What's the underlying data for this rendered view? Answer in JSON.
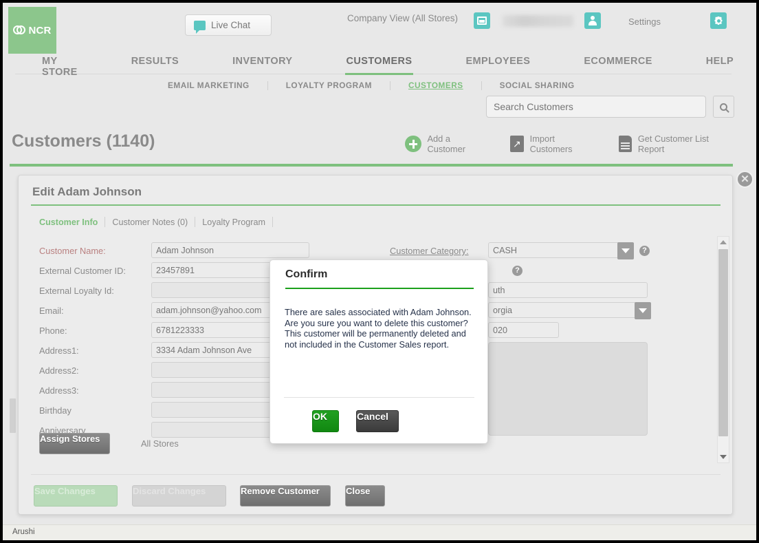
{
  "colors": {
    "brand_green": "#7ec07e",
    "teal": "#5bc6c1",
    "confirm_green": "#1ba01b",
    "page_bg": "#e8e8e8"
  },
  "header": {
    "logo_text": "NCR",
    "live_chat": "Live Chat",
    "company_view": "Company View (All Stores)",
    "settings": "Settings",
    "store_icon": "store-icon",
    "user_icon": "user-icon",
    "gear_icon": "gear-icon"
  },
  "mainnav": [
    {
      "label": "MY STORE",
      "active": false
    },
    {
      "label": "RESULTS",
      "active": false
    },
    {
      "label": "INVENTORY",
      "active": false
    },
    {
      "label": "CUSTOMERS",
      "active": true
    },
    {
      "label": "EMPLOYEES",
      "active": false
    },
    {
      "label": "ECOMMERCE",
      "active": false
    },
    {
      "label": "HELP",
      "active": false
    }
  ],
  "subnav": [
    {
      "label": "EMAIL MARKETING",
      "active": false
    },
    {
      "label": "LOYALTY PROGRAM",
      "active": false
    },
    {
      "label": "CUSTOMERS",
      "active": true
    },
    {
      "label": "SOCIAL SHARING",
      "active": false
    }
  ],
  "search": {
    "placeholder": "Search Customers",
    "value": "",
    "button_icon": "search-icon"
  },
  "page": {
    "title": "Customers (1140)",
    "actions": [
      {
        "label": "Add a Customer",
        "icon": "plus-circle-icon"
      },
      {
        "label": "Import Customers",
        "icon": "import-arrow-icon"
      },
      {
        "label": "Get Customer List Report",
        "icon": "document-list-icon"
      }
    ]
  },
  "modal": {
    "title": "Edit Adam Johnson",
    "close_label": "✕",
    "tabs": [
      {
        "label": "Customer Info",
        "active": true
      },
      {
        "label": "Customer Notes (0)",
        "active": false
      },
      {
        "label": "Loyalty Program",
        "active": false
      }
    ],
    "left_fields": [
      {
        "label": "Customer Name:",
        "value": "Adam Johnson",
        "required": true
      },
      {
        "label": "External Customer ID:",
        "value": "23457891",
        "required": false
      },
      {
        "label": "External Loyalty Id:",
        "value": "",
        "required": false
      },
      {
        "label": "Email:",
        "value": "adam.johnson@yahoo.com",
        "required": false
      },
      {
        "label": "Phone:",
        "value": "6781223333",
        "required": false
      },
      {
        "label": "Address1:",
        "value": "3334 Adam Johnson Ave",
        "required": false
      },
      {
        "label": "Address2:",
        "value": "",
        "required": false
      },
      {
        "label": "Address3:",
        "value": "",
        "required": false
      },
      {
        "label": "Birthday",
        "value": "",
        "required": false
      },
      {
        "label": "Anniversary",
        "value": "",
        "required": false
      }
    ],
    "right_fields": {
      "category_label": "Customer Category:",
      "category_value": "CASH",
      "city_value": "uth",
      "state_value": "orgia",
      "zip_value": "020"
    },
    "assign_stores_button": "Assign Stores",
    "all_stores_text": "All Stores",
    "footer_buttons": [
      {
        "label": "Save Changes",
        "state": "disabled"
      },
      {
        "label": "Discard Changes",
        "state": "disabled"
      },
      {
        "label": "Remove Customer",
        "state": "enabled"
      },
      {
        "label": "Close",
        "state": "enabled"
      }
    ]
  },
  "confirm": {
    "title": "Confirm",
    "message": "There are sales associated with Adam Johnson. Are you sure you want to delete this customer? This customer will be permanently deleted and not included in the Customer Sales report.",
    "ok_label": "OK",
    "cancel_label": "Cancel"
  },
  "status_bar": {
    "text": "Arushi"
  }
}
